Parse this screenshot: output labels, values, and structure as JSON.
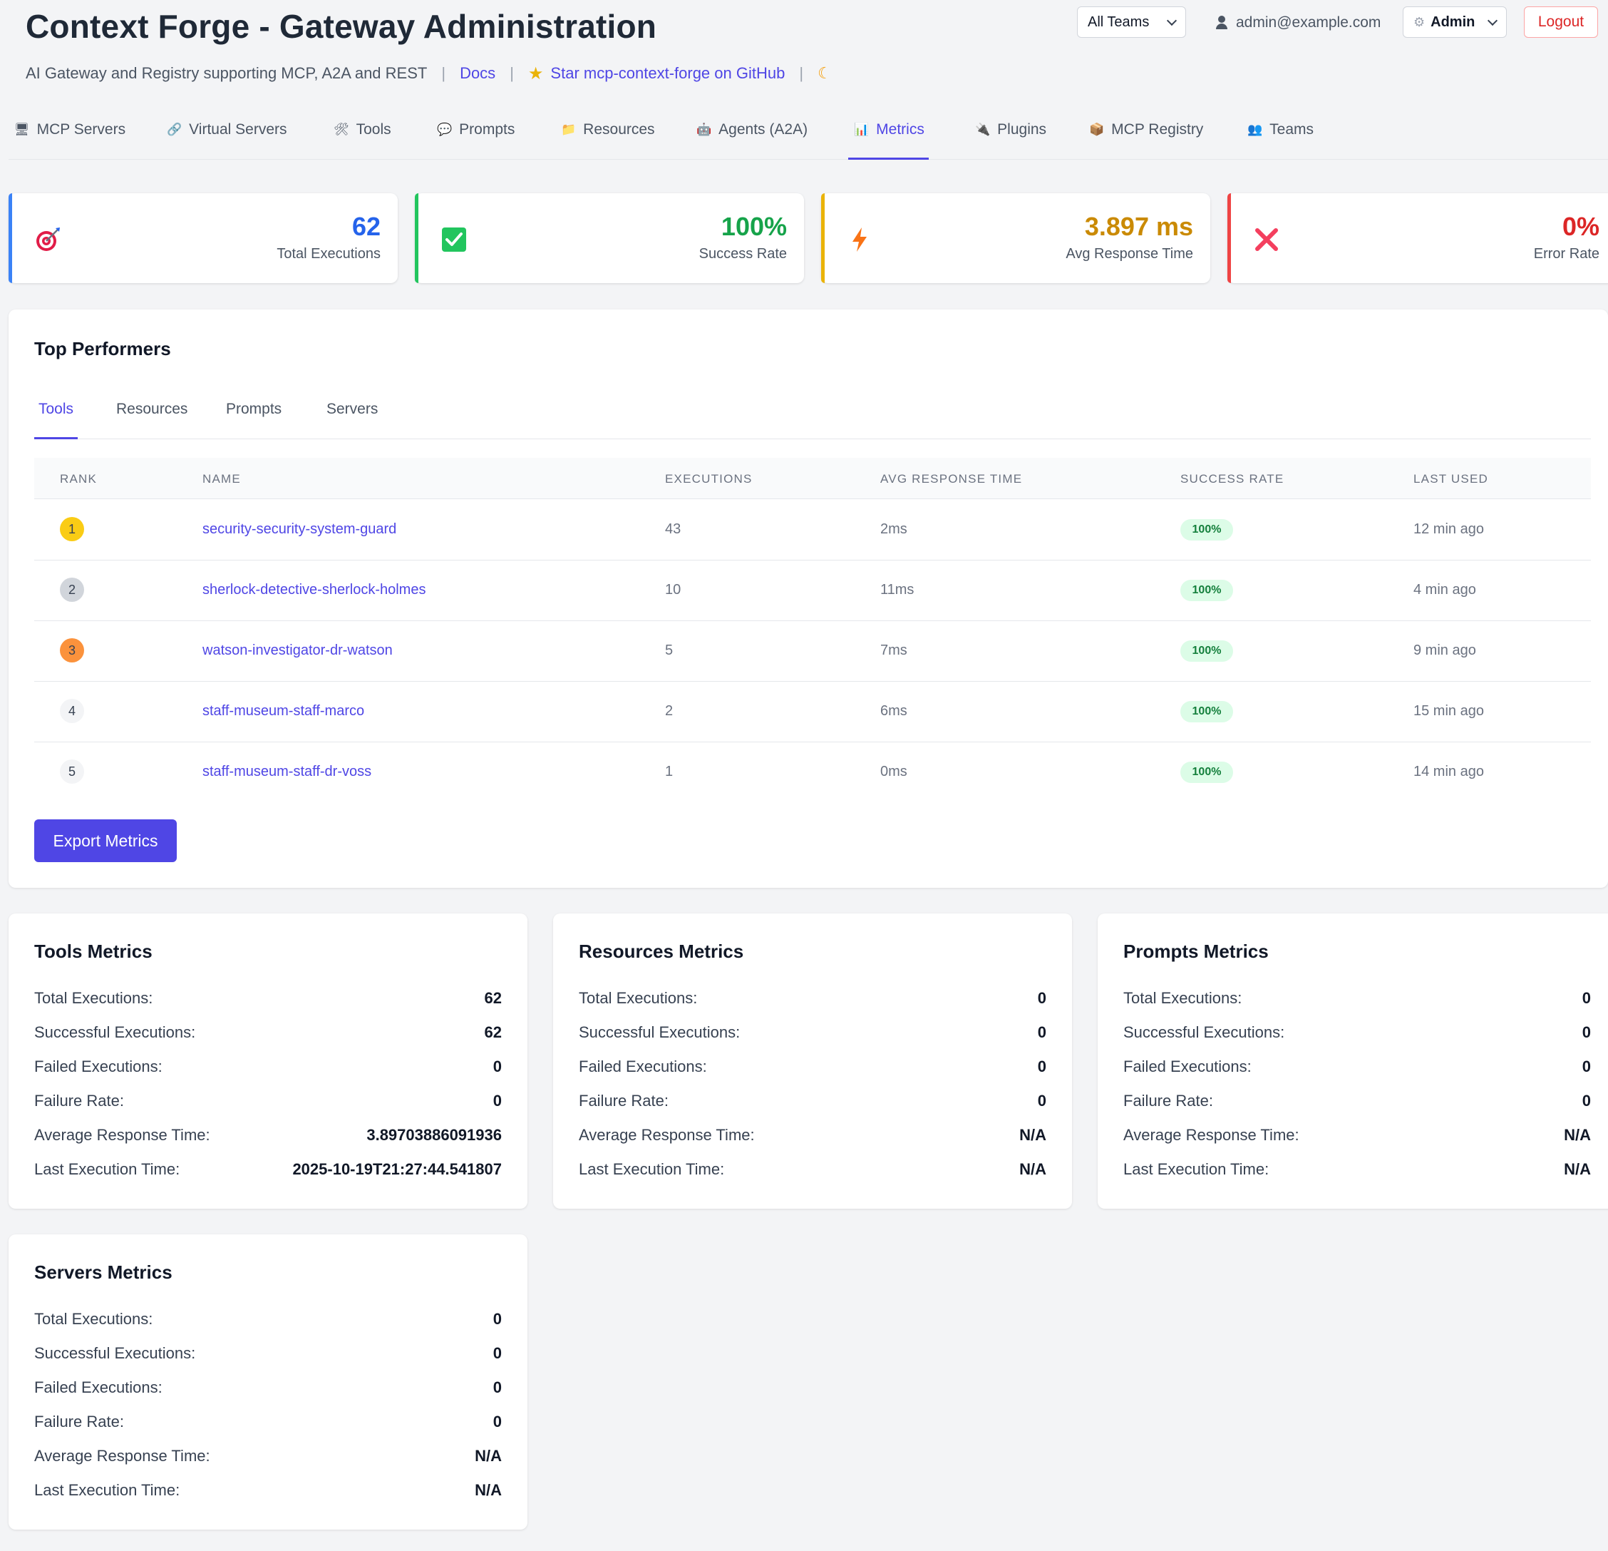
{
  "header": {
    "title": "Context Forge - Gateway Administration",
    "subtitle": "AI Gateway and Registry supporting MCP, A2A and REST",
    "separator": "|",
    "docs_label": "Docs",
    "github_label": "Star mcp-context-forge on GitHub",
    "star_icon": "★",
    "theme_icon": "☾",
    "team_select": "All Teams",
    "user_email": "admin@example.com",
    "role_select": "Admin",
    "gear_icon": "⚙",
    "logout_label": "Logout"
  },
  "nav": {
    "items": [
      {
        "label": "MCP Servers",
        "icon": "🖥"
      },
      {
        "label": "Virtual Servers",
        "icon": "🔗"
      },
      {
        "label": "Tools",
        "icon": "🛠"
      },
      {
        "label": "Prompts",
        "icon": "💬"
      },
      {
        "label": "Resources",
        "icon": "📁"
      },
      {
        "label": "Agents (A2A)",
        "icon": "🤖"
      },
      {
        "label": "Metrics",
        "icon": "📊"
      },
      {
        "label": "Plugins",
        "icon": "🔌"
      },
      {
        "label": "MCP Registry",
        "icon": "📦"
      },
      {
        "label": "Teams",
        "icon": "👥"
      }
    ],
    "active": "Metrics"
  },
  "stats": [
    {
      "value": "62",
      "label": "Total Executions",
      "icon": "target-icon",
      "color": "#2563eb"
    },
    {
      "value": "100%",
      "label": "Success Rate",
      "icon": "check-icon",
      "color": "#16a34a"
    },
    {
      "value": "3.897 ms",
      "label": "Avg Response Time",
      "icon": "lightning-icon",
      "color": "#ca8a04"
    },
    {
      "value": "0%",
      "label": "Error Rate",
      "icon": "cross-icon",
      "color": "#dc2626"
    }
  ],
  "top_performers": {
    "title": "Top Performers",
    "tabs": [
      "Tools",
      "Resources",
      "Prompts",
      "Servers"
    ],
    "active_tab": "Tools",
    "columns": [
      "Rank",
      "Name",
      "Executions",
      "Avg Response Time",
      "Success Rate",
      "Last Used"
    ],
    "rows": [
      {
        "rank": "1",
        "name": "security-security-system-guard",
        "executions": "43",
        "avg": "2ms",
        "success": "100%",
        "last_used": "12 min ago"
      },
      {
        "rank": "2",
        "name": "sherlock-detective-sherlock-holmes",
        "executions": "10",
        "avg": "11ms",
        "success": "100%",
        "last_used": "4 min ago"
      },
      {
        "rank": "3",
        "name": "watson-investigator-dr-watson",
        "executions": "5",
        "avg": "7ms",
        "success": "100%",
        "last_used": "9 min ago"
      },
      {
        "rank": "4",
        "name": "staff-museum-staff-marco",
        "executions": "2",
        "avg": "6ms",
        "success": "100%",
        "last_used": "15 min ago"
      },
      {
        "rank": "5",
        "name": "staff-museum-staff-dr-voss",
        "executions": "1",
        "avg": "0ms",
        "success": "100%",
        "last_used": "14 min ago"
      }
    ],
    "export_label": "Export Metrics"
  },
  "metric_cards": [
    {
      "title": "Tools Metrics",
      "rows": [
        {
          "label": "Total Executions:",
          "value": "62"
        },
        {
          "label": "Successful Executions:",
          "value": "62"
        },
        {
          "label": "Failed Executions:",
          "value": "0"
        },
        {
          "label": "Failure Rate:",
          "value": "0"
        },
        {
          "label": "Average Response Time:",
          "value": "3.89703886091936"
        },
        {
          "label": "Last Execution Time:",
          "value": "2025-10-19T21:27:44.541807"
        }
      ]
    },
    {
      "title": "Resources Metrics",
      "rows": [
        {
          "label": "Total Executions:",
          "value": "0"
        },
        {
          "label": "Successful Executions:",
          "value": "0"
        },
        {
          "label": "Failed Executions:",
          "value": "0"
        },
        {
          "label": "Failure Rate:",
          "value": "0"
        },
        {
          "label": "Average Response Time:",
          "value": "N/A"
        },
        {
          "label": "Last Execution Time:",
          "value": "N/A"
        }
      ]
    },
    {
      "title": "Prompts Metrics",
      "rows": [
        {
          "label": "Total Executions:",
          "value": "0"
        },
        {
          "label": "Successful Executions:",
          "value": "0"
        },
        {
          "label": "Failed Executions:",
          "value": "0"
        },
        {
          "label": "Failure Rate:",
          "value": "0"
        },
        {
          "label": "Average Response Time:",
          "value": "N/A"
        },
        {
          "label": "Last Execution Time:",
          "value": "N/A"
        }
      ]
    },
    {
      "title": "Servers Metrics",
      "rows": [
        {
          "label": "Total Executions:",
          "value": "0"
        },
        {
          "label": "Successful Executions:",
          "value": "0"
        },
        {
          "label": "Failed Executions:",
          "value": "0"
        },
        {
          "label": "Failure Rate:",
          "value": "0"
        },
        {
          "label": "Average Response Time:",
          "value": "N/A"
        },
        {
          "label": "Last Execution Time:",
          "value": "N/A"
        }
      ]
    }
  ]
}
